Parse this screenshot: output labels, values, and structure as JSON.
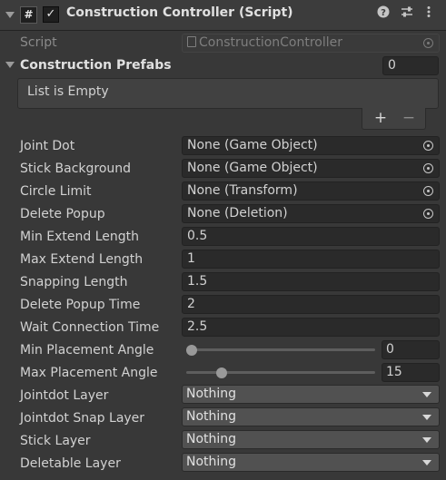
{
  "component": {
    "title": "Construction Controller (Script)",
    "script_icon": "#",
    "enabled_check": "✓",
    "help_icon": "question-circle-icon",
    "preset_icon": "sliders-icon",
    "menu_icon": "kebab-menu-icon"
  },
  "script_field": {
    "label": "Script",
    "value": "ConstructionController"
  },
  "prefabs": {
    "label": "Construction Prefabs",
    "count": "0",
    "empty_text": "List is Empty",
    "add_label": "+",
    "remove_label": "−"
  },
  "object_fields": [
    {
      "label": "Joint Dot",
      "value": "None (Game Object)"
    },
    {
      "label": "Stick Background",
      "value": "None (Game Object)"
    },
    {
      "label": "Circle Limit",
      "value": "None (Transform)"
    },
    {
      "label": "Delete Popup",
      "value": "None (Deletion)"
    }
  ],
  "number_fields": [
    {
      "label": "Min Extend Length",
      "value": "0.5"
    },
    {
      "label": "Max Extend Length",
      "value": "1"
    },
    {
      "label": "Snapping Length",
      "value": "1.5"
    },
    {
      "label": "Delete Popup Time",
      "value": "2"
    },
    {
      "label": "Wait Connection Time",
      "value": "2.5"
    }
  ],
  "sliders": [
    {
      "label": "Min Placement Angle",
      "value": "0",
      "fraction": 0.0
    },
    {
      "label": "Max Placement Angle",
      "value": "15",
      "fraction": 0.17
    }
  ],
  "dropdowns": [
    {
      "label": "Jointdot Layer",
      "value": "Nothing"
    },
    {
      "label": "Jointdot Snap Layer",
      "value": "Nothing"
    },
    {
      "label": "Stick Layer",
      "value": "Nothing"
    },
    {
      "label": "Deletable Layer",
      "value": "Nothing"
    }
  ]
}
